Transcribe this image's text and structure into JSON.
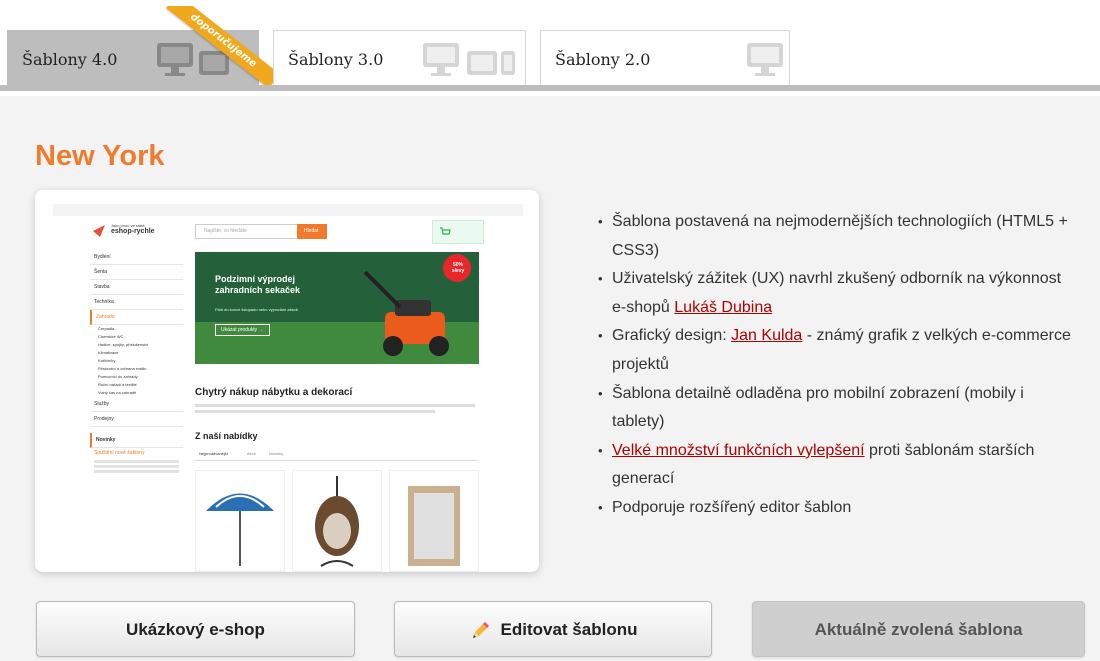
{
  "tabs": [
    {
      "label": "Šablony 4.0",
      "active": true
    },
    {
      "label": "Šablony 3.0",
      "active": false
    },
    {
      "label": "Šablony 2.0",
      "active": false
    }
  ],
  "ribbon": "doporučujeme",
  "template": {
    "name": "New York"
  },
  "features": [
    {
      "text": "Šablona postavená na nejmodernějších technologiích (HTML5 + CSS3)"
    },
    {
      "before": "Uživatelský zážitek (UX) navrhl zkušený odborník na výkonnost e-shopů ",
      "link": "Lukáš Dubina",
      "after": ""
    },
    {
      "before": "Grafický design: ",
      "link": "Jan Kulda",
      "after": " - známý grafik z velkých e-commerce projektů"
    },
    {
      "text": "Šablona detailně odladěna pro mobilní zobrazení (mobily i tablety)"
    },
    {
      "before": "",
      "link": "Velké množství funkčních vylepšení",
      "after": " proti šablonám starších generací"
    },
    {
      "text": "Podporuje rozšířený editor šablon"
    }
  ],
  "buttons": {
    "demo": "Ukázkový e-shop",
    "edit": "Editovat šablonu",
    "current": "Aktuálně zvolená šablona"
  },
  "preview": {
    "logo_text": "eshop-rychle",
    "logo_sub": "Jako první ve státě",
    "search_placeholder": "Napište, co hledáte",
    "search_button": "Hledat",
    "banner_title": "Podzimní výprodej zahradních sekaček",
    "banner_sub": "Platí do konce listopadu nebo vyprodání zásob",
    "banner_button": "Ukázat produkty →",
    "sale_badge": "50% slevy",
    "heading": "Chytrý nákup nábytku a dekorací",
    "offer_heading": "Z naší nabídky",
    "offer_tabs": [
      "Nejprodávanější",
      "Akce",
      "Novinky"
    ],
    "menu": [
      "Bydlení",
      "Šenta",
      "Stavba",
      "Technika",
      "Zahrada"
    ],
    "submenu": [
      "Čerpadla",
      "Chemické WC",
      "Hadice, spojky, příslušenství",
      "Klimatizace",
      "Kotlíčníky",
      "Pěstování a ochrana rostlin",
      "Pomocníci do zahrady",
      "Ruční nářadí a textilie",
      "Volný čas na zahradě"
    ],
    "menu_bottom": [
      "Služby",
      "Prodejny"
    ],
    "news_heading": "Novinky",
    "news_title": "Spuštění nové šablony",
    "colors": {
      "accent": "#f07b2e",
      "link": "#b00000",
      "active_tab": "#bdbdbd"
    }
  }
}
